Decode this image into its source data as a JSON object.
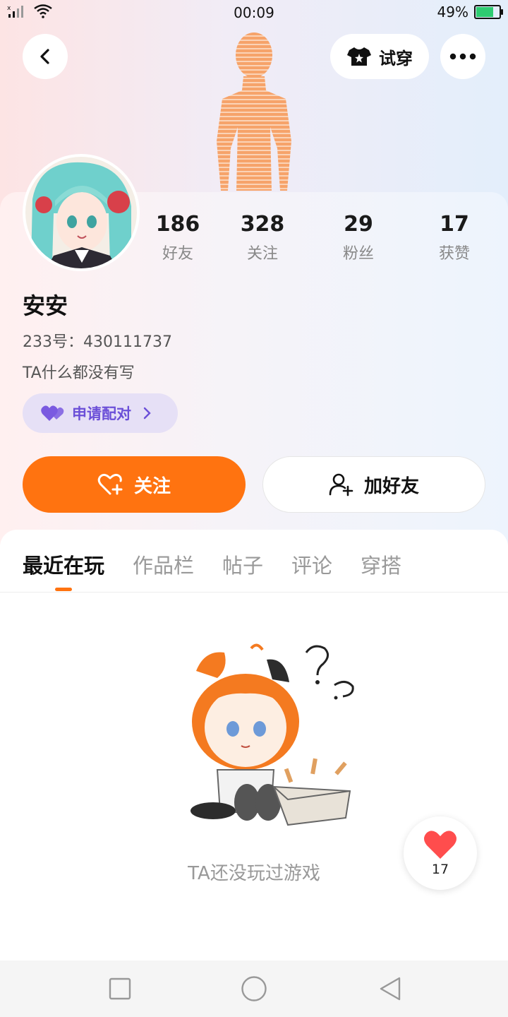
{
  "status_bar": {
    "time": "00:09",
    "battery": "49%"
  },
  "header": {
    "try_on_label": "试穿"
  },
  "stats": [
    {
      "value": "186",
      "label": "好友"
    },
    {
      "value": "328",
      "label": "关注"
    },
    {
      "value": "29",
      "label": "粉丝"
    },
    {
      "value": "17",
      "label": "获赞"
    }
  ],
  "profile": {
    "name": "安安",
    "uid": "233号：430111737",
    "bio": "TA什么都没有写",
    "pair_label": "申请配对"
  },
  "actions": {
    "follow_label": "关注",
    "add_friend_label": "加好友"
  },
  "tabs": [
    {
      "label": "最近在玩"
    },
    {
      "label": "作品栏"
    },
    {
      "label": "帖子"
    },
    {
      "label": "评论"
    },
    {
      "label": "穿搭"
    }
  ],
  "empty_state": {
    "text": "TA还没玩过游戏"
  },
  "like_fab": {
    "count": "17"
  },
  "colors": {
    "accent": "#ff7310",
    "pair": "#6b4fd8"
  }
}
